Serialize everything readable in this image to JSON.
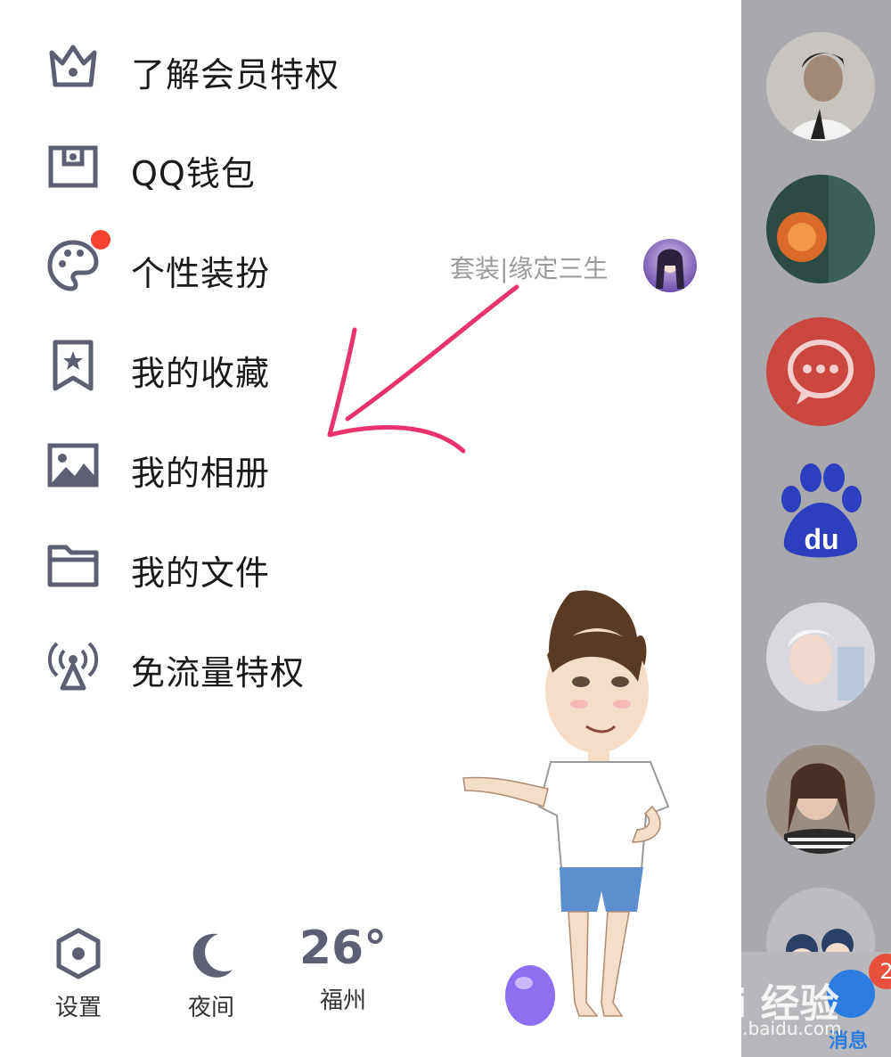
{
  "menu": {
    "items": [
      {
        "label": "了解会员特权",
        "icon": "crown-icon"
      },
      {
        "label": "QQ钱包",
        "icon": "wallet-icon"
      },
      {
        "label": "个性装扮",
        "icon": "palette-icon"
      },
      {
        "label": "我的收藏",
        "icon": "bookmark-star-icon"
      },
      {
        "label": "我的相册",
        "icon": "photo-icon"
      },
      {
        "label": "我的文件",
        "icon": "folder-icon"
      },
      {
        "label": "免流量特权",
        "icon": "signal-tower-icon"
      }
    ],
    "theme_tag": "套装|缘定三生"
  },
  "bottom": {
    "settings_label": "设置",
    "night_label": "夜间",
    "weather_temp": "26°",
    "weather_city": "福州"
  },
  "sidebar": {
    "messages_label": "消息",
    "badge_count": "2"
  },
  "watermark": {
    "brand": "Bai 经验",
    "url": "jingyan.baidu.com"
  },
  "colors": {
    "icon": "#5d6072",
    "annotation_arrow": "#e8336d",
    "notify_dot": "#f5412e",
    "accent_blue": "#2d7de0"
  }
}
